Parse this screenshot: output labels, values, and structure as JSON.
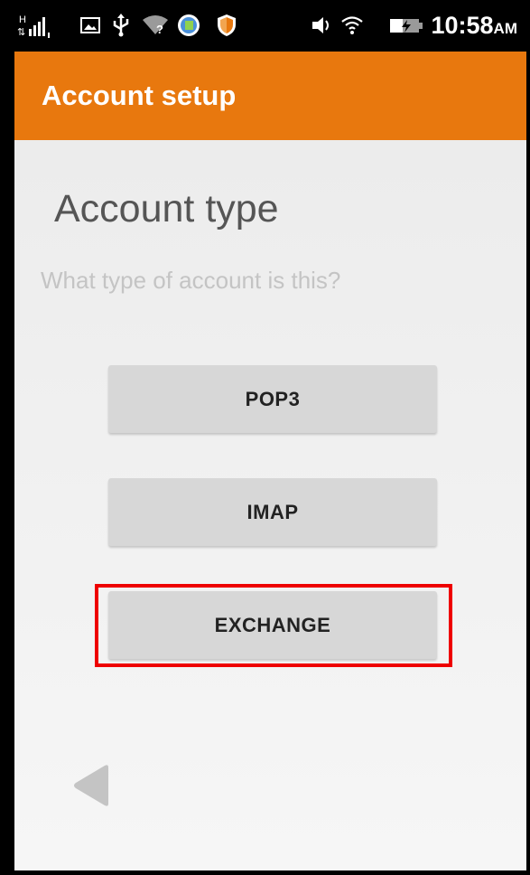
{
  "status_bar": {
    "signal_label": "H",
    "time": "10:58",
    "time_suffix": "AM",
    "icons": [
      "signal-icon",
      "image-icon",
      "usb-icon",
      "wifi-question-icon",
      "app-icon",
      "shield-icon",
      "volume-icon",
      "wifi-icon",
      "battery-icon"
    ]
  },
  "toolbar": {
    "title": "Account setup",
    "color": "#e8780e"
  },
  "main": {
    "heading": "Account type",
    "subheading": "What type of account is this?",
    "buttons": [
      {
        "label": "POP3"
      },
      {
        "label": "IMAP"
      },
      {
        "label": "EXCHANGE"
      }
    ]
  },
  "nav": {
    "back_icon": "back-triangle-icon"
  },
  "annotation": {
    "highlight_color": "#ee0000",
    "highlighted": "EXCHANGE"
  }
}
